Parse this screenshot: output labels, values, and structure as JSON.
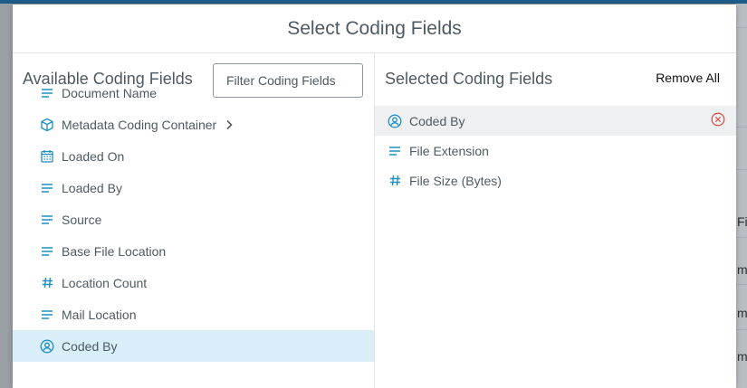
{
  "modal": {
    "title": "Select Coding Fields"
  },
  "available": {
    "heading": "Available Coding Fields",
    "filter_placeholder": "Filter Coding Fields",
    "items": [
      {
        "label": "Document Name",
        "icon": "text-lines-icon"
      },
      {
        "label": "Metadata Coding Container",
        "icon": "cube-icon",
        "has_children": true
      },
      {
        "label": "Loaded On",
        "icon": "calendar-icon"
      },
      {
        "label": "Loaded By",
        "icon": "text-lines-icon"
      },
      {
        "label": "Source",
        "icon": "text-lines-icon"
      },
      {
        "label": "Base File Location",
        "icon": "text-lines-icon"
      },
      {
        "label": "Location Count",
        "icon": "hash-icon"
      },
      {
        "label": "Mail Location",
        "icon": "text-lines-icon"
      },
      {
        "label": "Coded By",
        "icon": "user-circle-icon",
        "selected": true
      }
    ]
  },
  "selected": {
    "heading": "Selected Coding Fields",
    "remove_all_label": "Remove All",
    "items": [
      {
        "label": "Coded By",
        "icon": "user-circle-icon",
        "hovered": true
      },
      {
        "label": "File Extension",
        "icon": "text-lines-icon"
      },
      {
        "label": "File Size (Bytes)",
        "icon": "hash-icon"
      }
    ]
  },
  "colors": {
    "icon_accent": "#1f8fc4",
    "selected_row": "#d9eef8",
    "remove_icon": "#d9534f",
    "text": "#4e5a63"
  },
  "background": {
    "fragments": [
      "Fi",
      "m",
      "m",
      "m"
    ]
  }
}
